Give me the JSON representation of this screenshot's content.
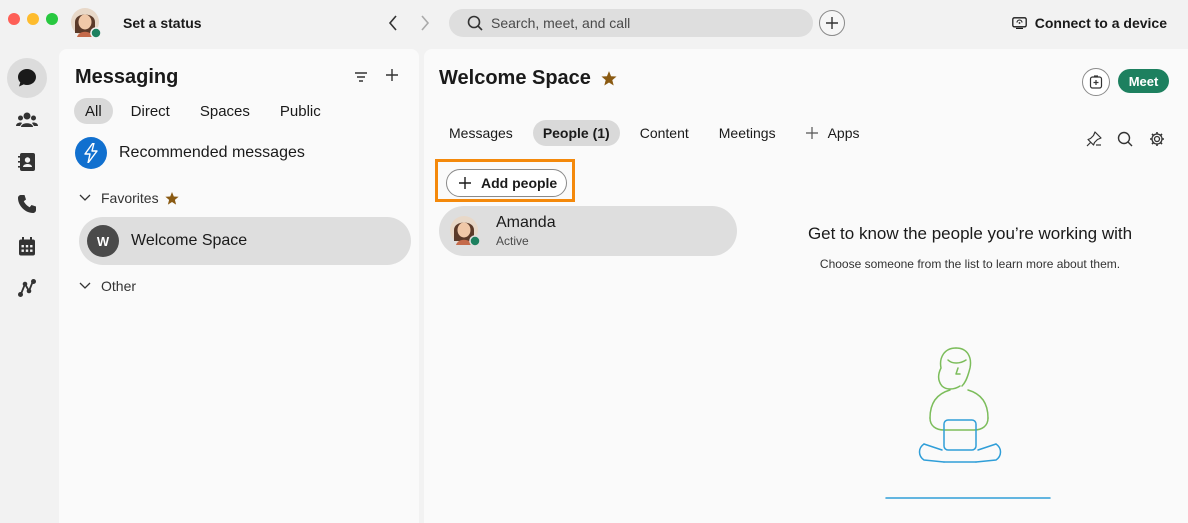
{
  "window": {
    "status_label": "Set a status",
    "search_placeholder": "Search, meet, and call",
    "connect_label": "Connect to a device"
  },
  "rail": {
    "items": [
      {
        "name": "messaging-icon",
        "active": true
      },
      {
        "name": "teams-icon",
        "active": false
      },
      {
        "name": "contacts-icon",
        "active": false
      },
      {
        "name": "calling-icon",
        "active": false
      },
      {
        "name": "calendar-icon",
        "active": false
      },
      {
        "name": "workflows-icon",
        "active": false
      }
    ]
  },
  "messaging": {
    "title": "Messaging",
    "filters": [
      "All",
      "Direct",
      "Spaces",
      "Public"
    ],
    "active_filter": "All",
    "recommended": "Recommended messages",
    "favorites_label": "Favorites",
    "other_label": "Other",
    "spaces": [
      {
        "initial": "W",
        "name": "Welcome Space",
        "selected": true
      }
    ]
  },
  "space": {
    "title": "Welcome Space",
    "meet_label": "Meet",
    "tabs": [
      "Messages",
      "People (1)",
      "Content",
      "Meetings",
      "Apps"
    ],
    "active_tab": "People (1)",
    "add_people_label": "Add people",
    "people": [
      {
        "name": "Amanda",
        "status": "Active"
      }
    ],
    "empty_title": "Get to know the people you’re working with",
    "empty_subtitle": "Choose someone from the list to learn more about them."
  },
  "colors": {
    "accent_green": "#1d805f",
    "presence_green": "#1d805f",
    "highlight_orange": "#f4890b",
    "favorite_star": "#8a5a12",
    "illustration_green": "#7cbd5b",
    "illustration_blue": "#2f9ed8"
  }
}
